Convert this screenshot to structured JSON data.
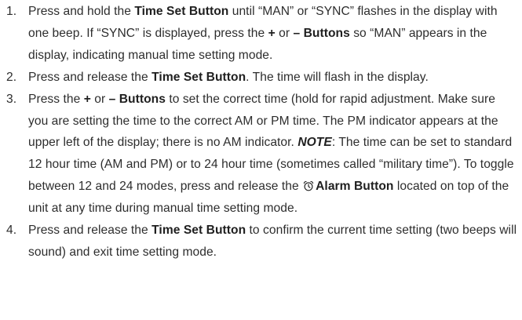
{
  "steps": [
    {
      "num": "1.",
      "p1": "Press and hold the ",
      "b1": "Time Set Button",
      "p2": " until “MAN” or “SYNC” flashes in the display with one beep. If “SYNC” is displayed, press the ",
      "b2": "+",
      "p3": " or ",
      "b3": "– Buttons",
      "p4": " so “MAN” appears in the display, indicating manual time setting mode."
    },
    {
      "num": "2.",
      "p1": "Press and release the ",
      "b1": "Time Set Button",
      "p2": ". The time will flash in the display."
    },
    {
      "num": "3.",
      "p1": "Press the ",
      "b1": "+",
      "p2": " or ",
      "b2": "– Buttons",
      "p3": " to set the correct time (hold for rapid adjustment. Make sure you are setting the time to the correct AM or PM time. The PM indicator appears at the upper left of the display; there is no AM indicator. ",
      "note_label": "NOTE",
      "p4": ": The time can be set to standard 12 hour time (AM and PM) or to 24 hour time (sometimes called “military time”). To toggle between 12 and 24 modes, press and release the ",
      "icon": "alarm-clock-icon",
      "b3": "Alarm Button",
      "p5": " located on top of the unit at any time during manual time setting mode."
    },
    {
      "num": "4.",
      "p1": "Press and release the ",
      "b1": "Time Set Button",
      "p2": " to confirm the current time setting (two beeps will sound) and exit time setting mode."
    }
  ],
  "colors": {
    "text": "#2d2d2d",
    "bold_text": "#1f1f1f",
    "background": "#ffffff"
  }
}
